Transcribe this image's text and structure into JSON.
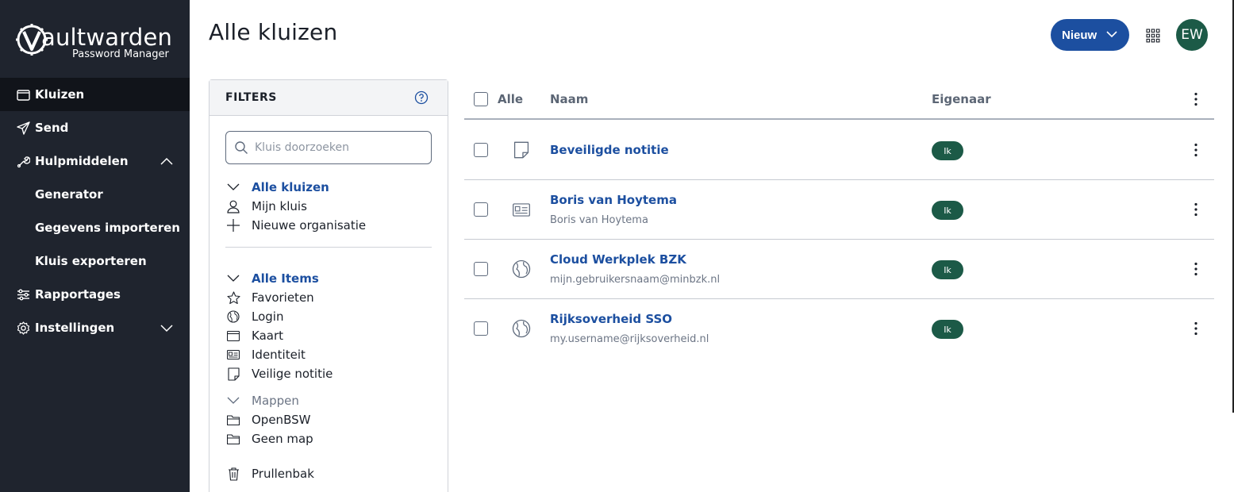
{
  "app": {
    "brand": "aultwarden",
    "brand_initial": "V",
    "subtitle": "Password Manager"
  },
  "sidebar": {
    "items": [
      {
        "label": "Kluizen",
        "icon": "vault-icon",
        "active": true
      },
      {
        "label": "Send",
        "icon": "paper-plane-icon"
      },
      {
        "label": "Hulpmiddelen",
        "icon": "wrench-icon",
        "expanded": true
      },
      {
        "label": "Rapportages",
        "icon": "sliders-icon"
      },
      {
        "label": "Instellingen",
        "icon": "gear-icon",
        "expanded": false
      }
    ],
    "subitems": [
      {
        "label": "Generator"
      },
      {
        "label": "Gegevens importeren"
      },
      {
        "label": "Kluis exporteren"
      }
    ]
  },
  "header": {
    "title": "Alle kluizen",
    "new_button": "Nieuw",
    "avatar_initials": "EW"
  },
  "filters": {
    "title": "FILTERS",
    "search_placeholder": "Kluis doorzoeken",
    "vaults_header": "Alle kluizen",
    "vaults": [
      "Mijn kluis",
      "Nieuwe organisatie"
    ],
    "items_header": "Alle Items",
    "types": [
      "Favorieten",
      "Login",
      "Kaart",
      "Identiteit",
      "Veilige notitie"
    ],
    "folders_header": "Mappen",
    "folders": [
      "OpenBSW",
      "Geen map"
    ],
    "trash": "Prullenbak"
  },
  "table": {
    "columns": {
      "all": "Alle",
      "name": "Naam",
      "owner": "Eigenaar"
    },
    "rows": [
      {
        "name": "Beveiligde notitie",
        "subtitle": "",
        "type": "note-icon",
        "owner": "Ik"
      },
      {
        "name": "Boris van Hoytema",
        "subtitle": "Boris van Hoytema",
        "type": "id-card-icon",
        "owner": "Ik"
      },
      {
        "name": "Cloud Werkplek BZK",
        "subtitle": "mijn.gebruikersnaam@minbzk.nl",
        "type": "globe-icon",
        "owner": "Ik"
      },
      {
        "name": "Rijksoverheid SSO",
        "subtitle": "my.username@rijksoverheid.nl",
        "type": "globe-icon",
        "owner": "Ik"
      }
    ]
  },
  "colors": {
    "sidebar_bg": "#1f242e",
    "accent": "#1c4fa0",
    "badge": "#1c5a47"
  }
}
